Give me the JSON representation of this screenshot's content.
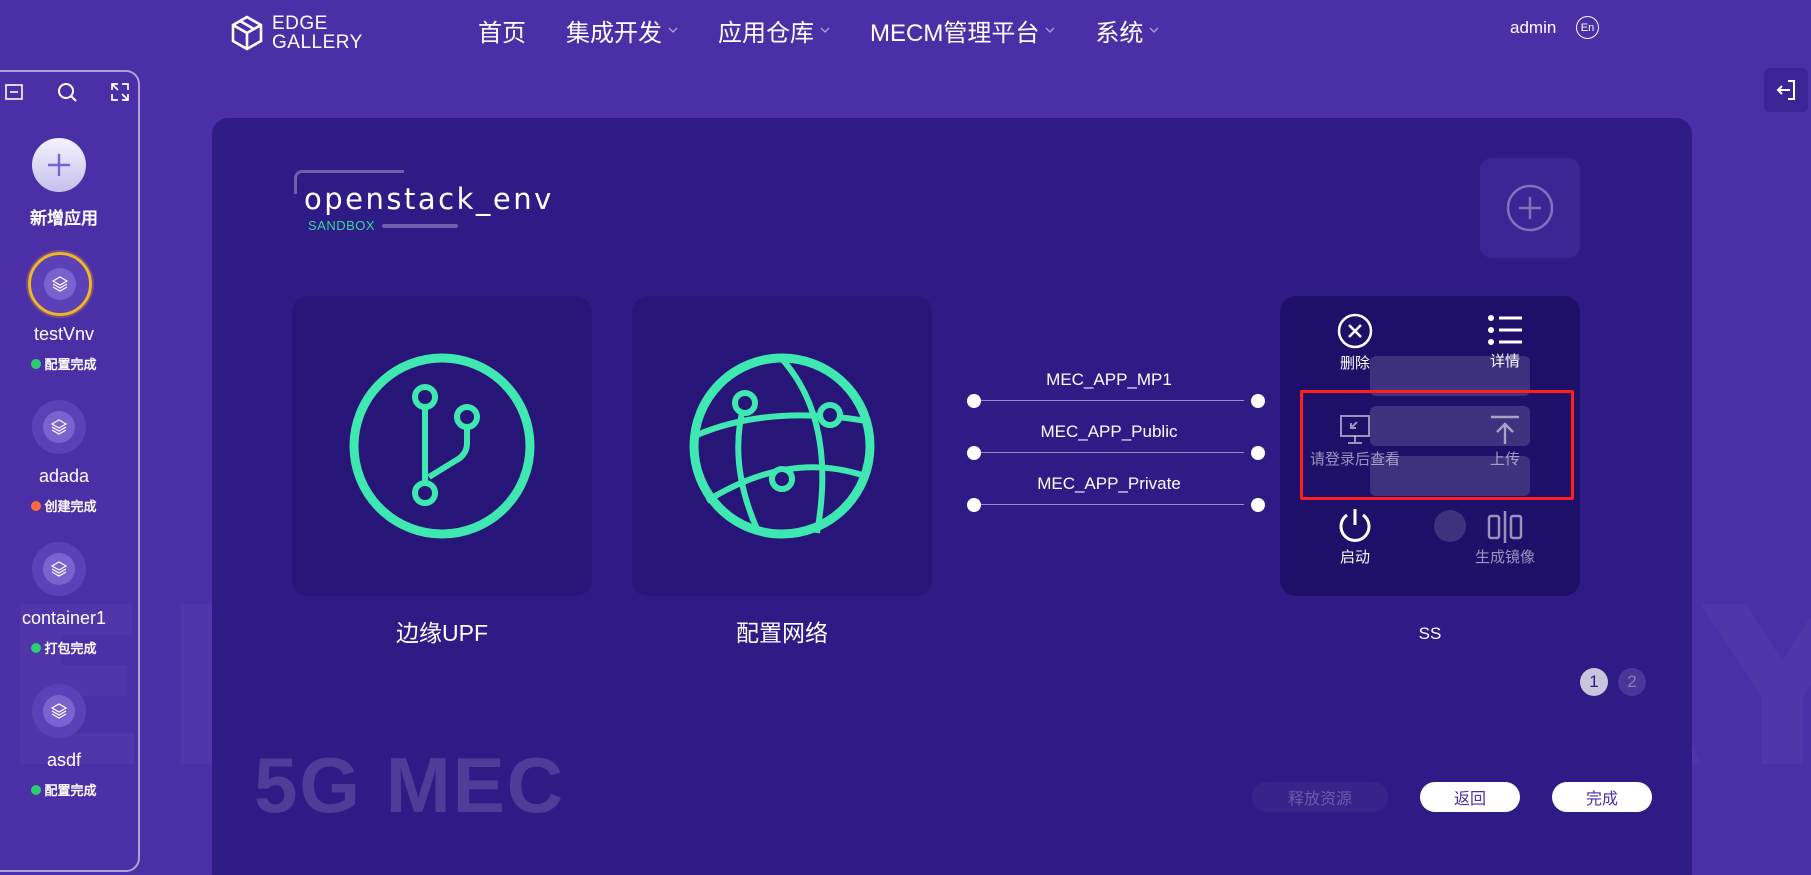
{
  "brand": {
    "line1": "EDGE",
    "line2": "GALLERY"
  },
  "nav": [
    {
      "label": "首页",
      "has_dropdown": false
    },
    {
      "label": "集成开发",
      "has_dropdown": true
    },
    {
      "label": "应用仓库",
      "has_dropdown": true
    },
    {
      "label": "MECM管理平台",
      "has_dropdown": true
    },
    {
      "label": "系统",
      "has_dropdown": true
    }
  ],
  "user": {
    "name": "admin",
    "lang": "En"
  },
  "sidebar": {
    "add_label": "新增应用",
    "apps": [
      {
        "name": "testVnv",
        "status": "配置完成",
        "status_color": "#2ecc71",
        "selected": true
      },
      {
        "name": "adada",
        "status": "创建完成",
        "status_color": "#ff6b3d",
        "selected": false
      },
      {
        "name": "container1",
        "status": "打包完成",
        "status_color": "#2ecc71",
        "selected": false
      },
      {
        "name": "asdf",
        "status": "配置完成",
        "status_color": "#2ecc71",
        "selected": false
      }
    ]
  },
  "env": {
    "name": "openstack_env",
    "sub": "SANDBOX"
  },
  "cards": [
    {
      "label": "边缘UPF",
      "icon": "branch-icon"
    },
    {
      "label": "配置网络",
      "icon": "globe-network-icon"
    }
  ],
  "networks": [
    "MEC_APP_MP1",
    "MEC_APP_Public",
    "MEC_APP_Private"
  ],
  "app_card": {
    "name": "SS",
    "actions": {
      "delete": "删除",
      "detail": "详情",
      "view": "请登录后查看",
      "upload": "上传",
      "start": "启动",
      "image": "生成镜像"
    }
  },
  "pagination": {
    "pages": [
      "1",
      "2"
    ],
    "current": 1
  },
  "watermark": "5G MEC",
  "buttons": {
    "release": "释放资源",
    "back": "返回",
    "done": "完成"
  },
  "colors": {
    "background": "#4a2fa6",
    "panel": "#2f1b86",
    "accent": "#3ee8b0",
    "highlight": "#ff1f1f"
  }
}
